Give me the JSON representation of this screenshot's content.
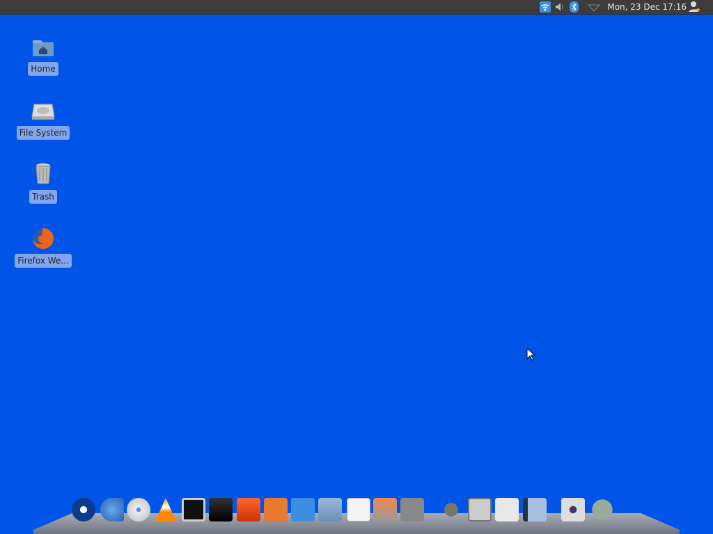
{
  "panel": {
    "clock": "Mon, 23 Dec  17:16",
    "tray_icons": [
      "wifi-icon",
      "volume-icon",
      "bluetooth-icon",
      "network-icon",
      "user-icon"
    ]
  },
  "desktop": {
    "icons": [
      {
        "label": "Home",
        "icon": "home-folder-icon"
      },
      {
        "label": "File System",
        "icon": "hard-drive-icon"
      },
      {
        "label": "Trash",
        "icon": "trash-icon"
      },
      {
        "label": "Firefox We...",
        "icon": "firefox-icon"
      }
    ]
  },
  "dock": {
    "items": [
      "xfce-menu",
      "euro-finance",
      "cd-burner",
      "vlc",
      "terminal",
      "display",
      "software-center",
      "software-updater",
      "download-manager",
      "file-manager",
      "text-editor",
      "disk-utility",
      "search",
      "gimp",
      "calculator",
      "settings",
      "notebook-editor",
      "camera",
      "system-monitor"
    ]
  },
  "colors": {
    "desktop": "#0055e8",
    "panel": "#3c3c3c"
  }
}
